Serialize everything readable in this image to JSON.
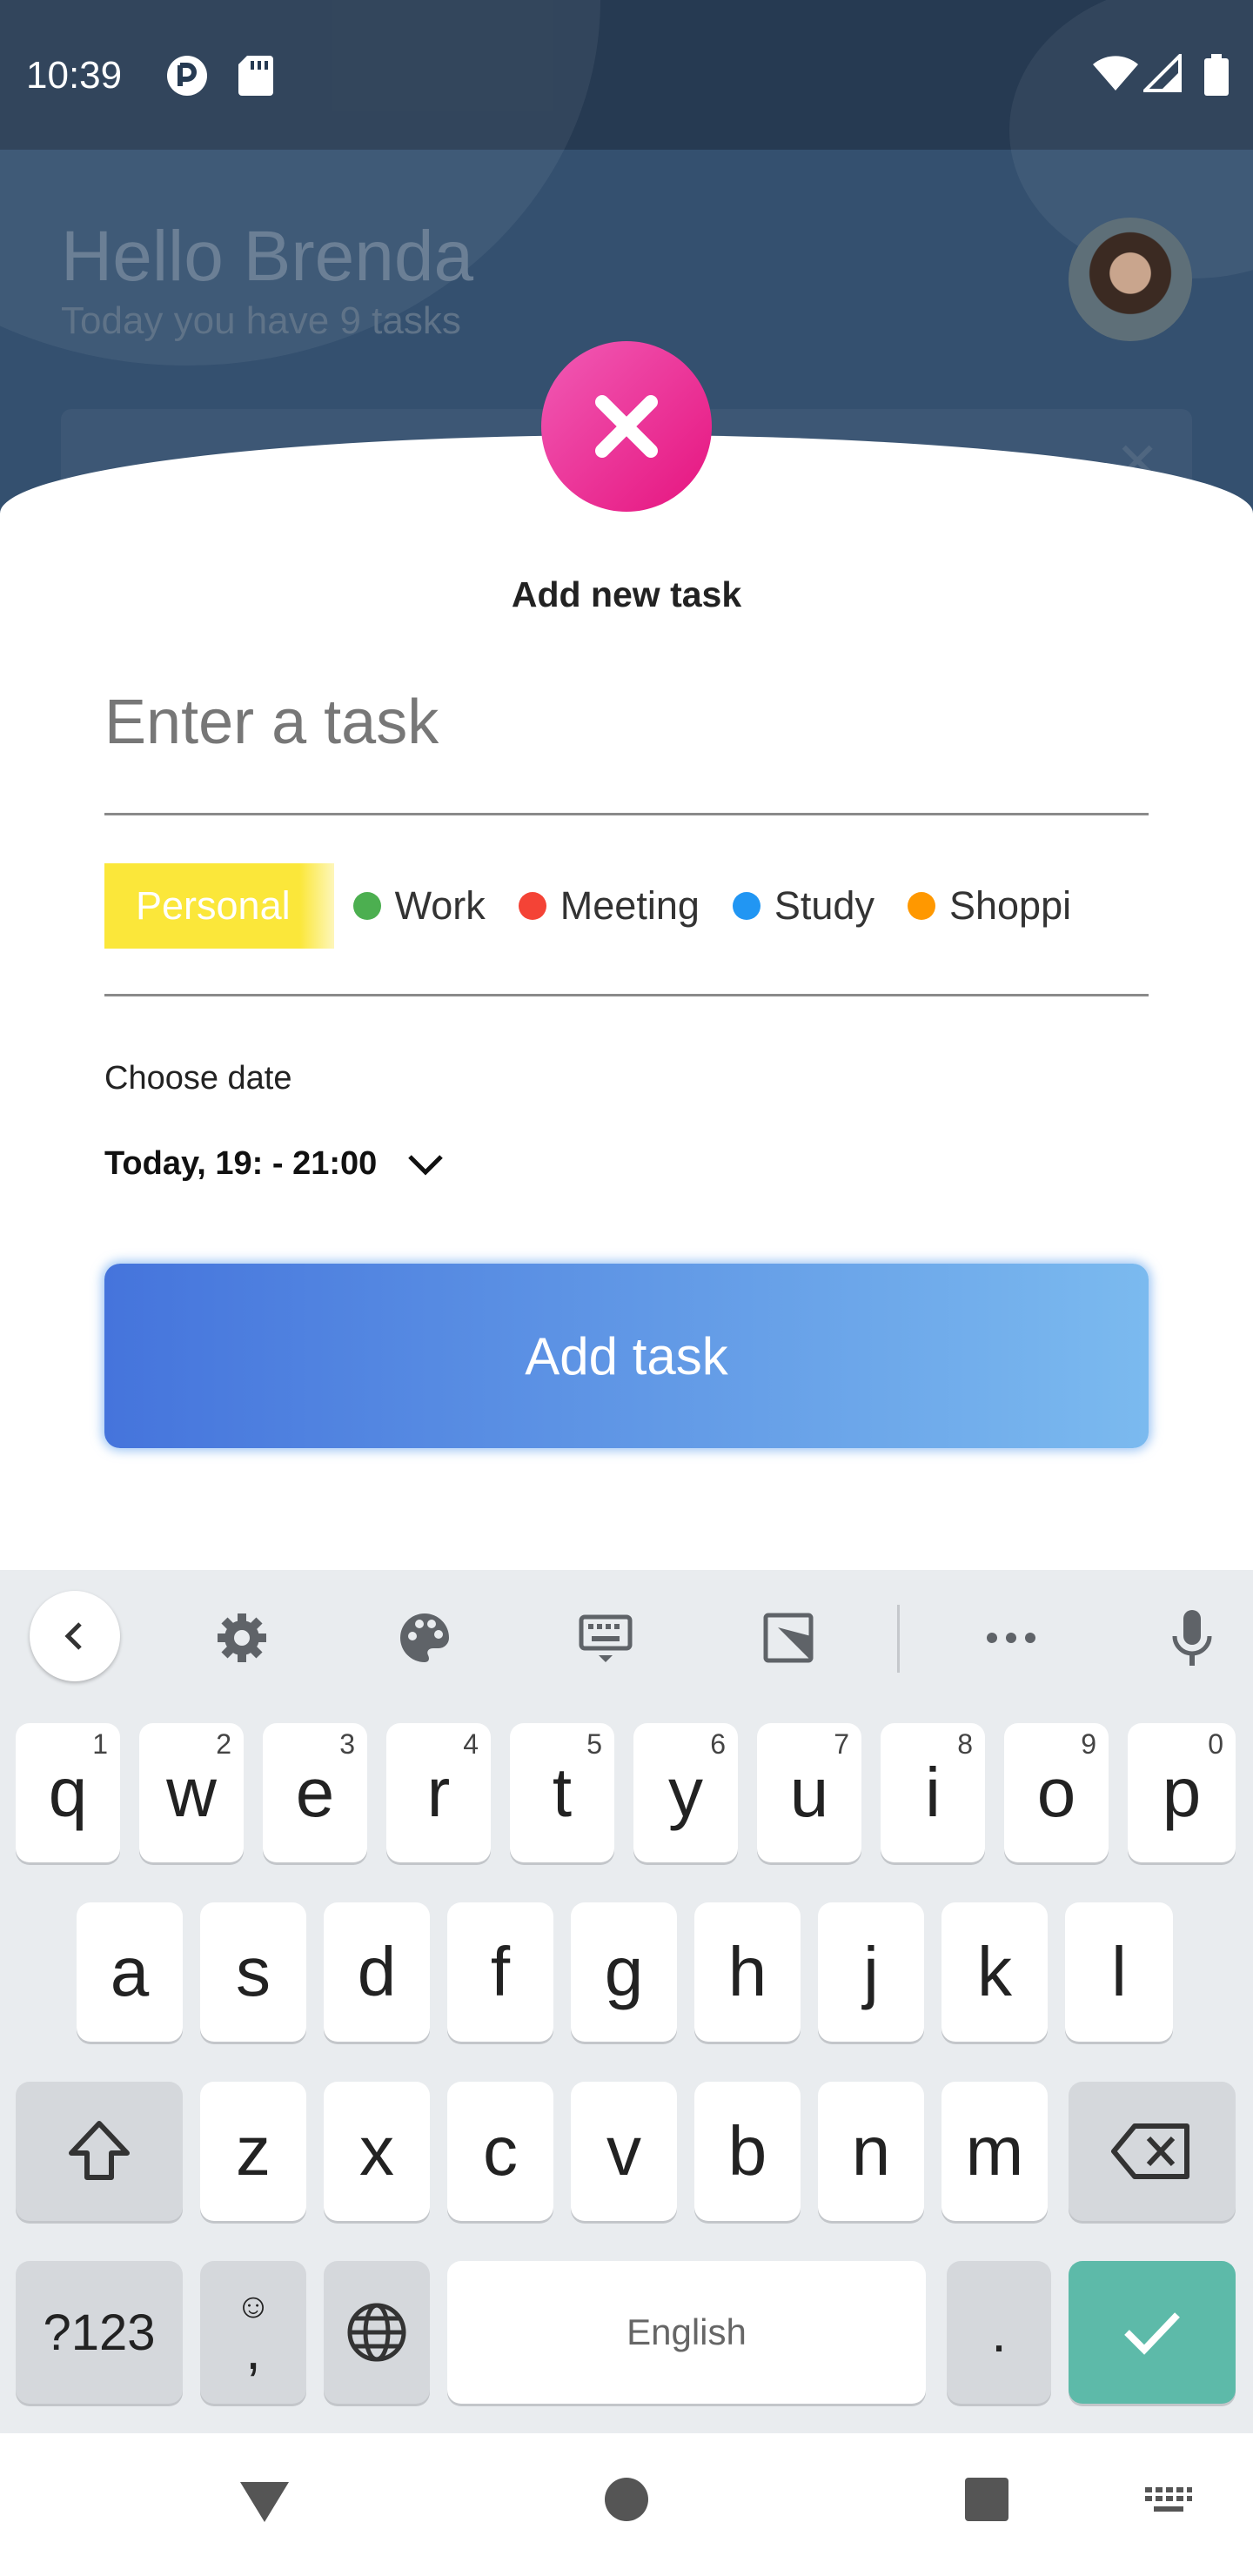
{
  "status_bar": {
    "time": "10:39"
  },
  "background": {
    "greeting": "Hello Brenda",
    "subtitle": "Today you have 9 tasks"
  },
  "dialog": {
    "title": "Add new task",
    "task_placeholder": "Enter a task",
    "categories": [
      {
        "label": "Personal",
        "color": "#fbe73a",
        "selected": true
      },
      {
        "label": "Work",
        "color": "#4caf50",
        "selected": false
      },
      {
        "label": "Meeting",
        "color": "#f44336",
        "selected": false
      },
      {
        "label": "Study",
        "color": "#2196f3",
        "selected": false
      },
      {
        "label": "Shoppi",
        "color": "#ff9800",
        "selected": false
      }
    ],
    "choose_date_label": "Choose date",
    "date_value": "Today, 19: - 21:00",
    "add_button": "Add task"
  },
  "keyboard": {
    "row1": [
      {
        "key": "q",
        "hint": "1"
      },
      {
        "key": "w",
        "hint": "2"
      },
      {
        "key": "e",
        "hint": "3"
      },
      {
        "key": "r",
        "hint": "4"
      },
      {
        "key": "t",
        "hint": "5"
      },
      {
        "key": "y",
        "hint": "6"
      },
      {
        "key": "u",
        "hint": "7"
      },
      {
        "key": "i",
        "hint": "8"
      },
      {
        "key": "o",
        "hint": "9"
      },
      {
        "key": "p",
        "hint": "0"
      }
    ],
    "row2": [
      "a",
      "s",
      "d",
      "f",
      "g",
      "h",
      "j",
      "k",
      "l"
    ],
    "row3": [
      "z",
      "x",
      "c",
      "v",
      "b",
      "n",
      "m"
    ],
    "symbols_key": "?123",
    "comma_key": ",",
    "space_label": "English",
    "period_key": "."
  },
  "colors": {
    "accent_pink": "#e6147f",
    "button_gradient_start": "#4574dc",
    "button_gradient_end": "#7bbaef",
    "enter_key": "#5dbaa9"
  }
}
